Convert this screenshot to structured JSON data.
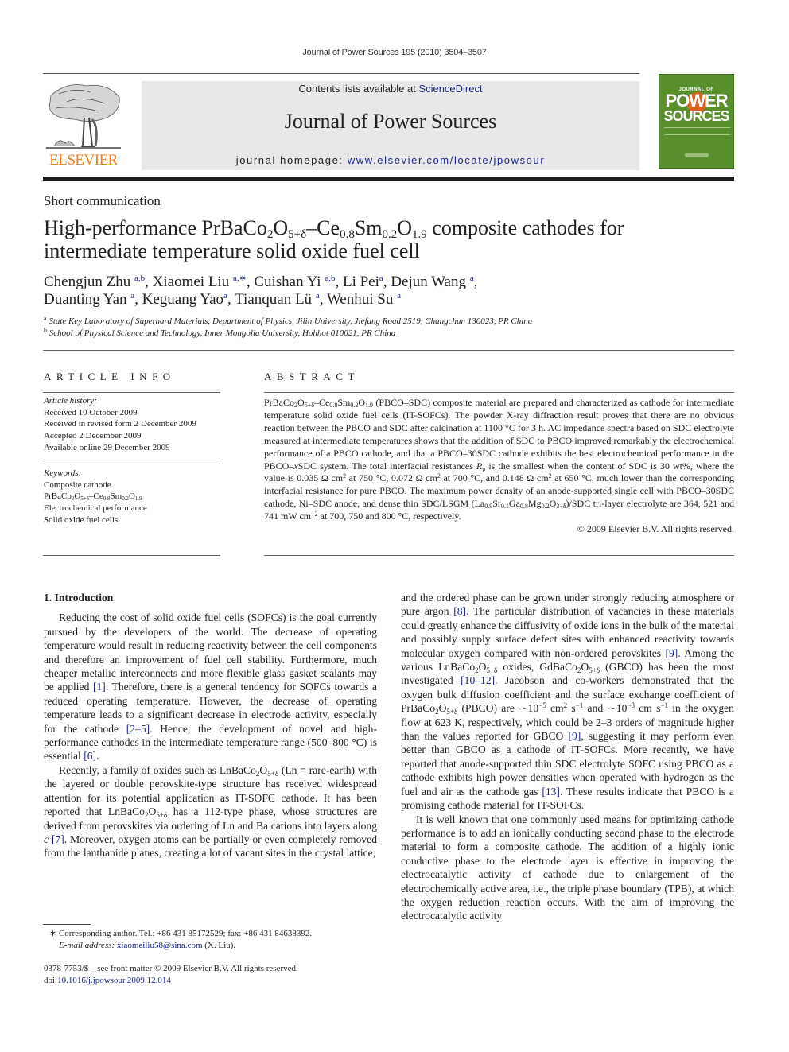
{
  "running_head": "Journal of Power Sources 195 (2010) 3504–3507",
  "banner": {
    "contents_prefix": "Contents lists available at ",
    "contents_link": "ScienceDirect",
    "journal_title": "Journal of Power Sources",
    "homepage_prefix": "journal homepage: ",
    "homepage_link": "www.elsevier.com/locate/jpowsour"
  },
  "publisher_logo": {
    "name": "ELSEVIER",
    "color": "#f07d1a",
    "icon": "elsevier-tree-icon"
  },
  "cover": {
    "line1": "JOURNAL OF",
    "line2": "POWER",
    "line3": "SOURCES",
    "color": "#5a8f2e",
    "accent": "#d9601f"
  },
  "article": {
    "section_type": "Short communication",
    "title_parts": {
      "t1": "High-performance PrBaCo",
      "s1": "2",
      "t2": "O",
      "s2": "5+δ",
      "t3": "–Ce",
      "s3": "0.8",
      "t4": "Sm",
      "s4": "0.2",
      "t5": "O",
      "s5": "1.9",
      "t6": " composite cathodes for",
      "line2": "intermediate temperature solid oxide fuel cell"
    },
    "authors": [
      {
        "name": "Chengjun Zhu",
        "aff": "a,b",
        "sep": ", "
      },
      {
        "name": "Xiaomei Liu",
        "aff": "a,∗",
        "sep": ", "
      },
      {
        "name": "Cuishan Yi",
        "aff": "a,b",
        "sep": ", "
      },
      {
        "name": "Li Pei",
        "aff": "a",
        "sep": ", "
      },
      {
        "name": "Dejun Wang",
        "aff": "a",
        "sep": ","
      },
      {
        "name": "Duanting Yan",
        "aff": "a",
        "sep": ", "
      },
      {
        "name": "Keguang Yao",
        "aff": "a",
        "sep": ", "
      },
      {
        "name": "Tianquan Lü",
        "aff": "a",
        "sep": ", "
      },
      {
        "name": "Wenhui Su",
        "aff": "a",
        "sep": ""
      }
    ],
    "affiliations": [
      {
        "key": "a",
        "text": "State Key Laboratory of Superhard Materials, Department of Physics, Jilin University, Jiefang Road 2519, Changchun 130023, PR China"
      },
      {
        "key": "b",
        "text": "School of Physical Science and Technology, Inner Mongolia University, Hohhot 010021, PR China"
      }
    ]
  },
  "article_info": {
    "heading": "ARTICLE INFO",
    "history_label": "Article history:",
    "history": [
      "Received 10 October 2009",
      "Received in revised form 2 December 2009",
      "Accepted 2 December 2009",
      "Available online 29 December 2009"
    ],
    "keywords_label": "Keywords:",
    "keywords": {
      "k1": "Composite cathode",
      "k2_parts": {
        "a": "PrBaCo",
        "b": "2",
        "c": "O",
        "d": "5+δ",
        "e": "–Ce",
        "f": "0.8",
        "g": "Sm",
        "h": "0.2",
        "i": "O",
        "j": "1.9"
      },
      "k3": "Electrochemical performance",
      "k4": "Solid oxide fuel cells"
    }
  },
  "abstract": {
    "heading": "ABSTRACT",
    "p": {
      "a1": "PrBaCo",
      "a1s": "2",
      "a2": "O",
      "a2s": "5+δ",
      "a3": "–Ce",
      "a3s": "0.8",
      "a4": "Sm",
      "a4s": "0.2",
      "a5": "O",
      "a5s": "1.9",
      "a6": " (PBCO–SDC) composite material are prepared and characterized as cathode for intermediate temperature solid oxide fuel cells (IT-SOFCs). The powder X-ray diffraction result proves that there are no obvious reaction between the PBCO and SDC after calcination at 1100 °C for 3 h. AC impedance spectra based on SDC electrolyte measured at intermediate temperatures shows that the addition of SDC to PBCO improved remarkably the electrochemical performance of a PBCO cathode, and that a PBCO–30SDC cathode exhibits the best electrochemical performance in the PBCO–",
      "a7": "x",
      "a8": "SDC system. The total interfacial resistances ",
      "a9": "R",
      "a9s": "p",
      "a10": " is the smallest when the content of SDC is 30 wt%, where the value is 0.035 Ω cm",
      "sq": "2",
      "a11": " at 750 °C, 0.072 Ω cm",
      "a12": " at 700 °C, and 0.148 Ω cm",
      "a13": " at 650 °C, much lower than the corresponding interfacial resistance for pure PBCO. The maximum power density of an anode-supported single cell with PBCO–30SDC cathode, Ni–SDC anode, and dense thin SDC/LSGM (La",
      "b1s": "0.9",
      "b2": "Sr",
      "b2s": "0.1",
      "b3": "Ga",
      "b3s": "0.8",
      "b4": "Mg",
      "b4s": "0.2",
      "b5": "O",
      "b5s": "3−δ",
      "b6": ")/SDC tri-layer electrolyte are 364, 521 and 741 mW cm",
      "b6sup": "−2",
      "b7": " at 700, 750 and 800 °C, respectively."
    },
    "copyright": "© 2009 Elsevier B.V. All rights reserved."
  },
  "body": {
    "section_heading": "1.  Introduction",
    "left": {
      "p1a": "Reducing the cost of solid oxide fuel cells (SOFCs) is the goal currently pursued by the developers of the world. The decrease of operating temperature would result in reducing reactivity between the cell components and therefore an improvement of fuel cell stability. Furthermore, much cheaper metallic interconnects and more flexible glass gasket sealants may be applied ",
      "ref1": "[1]",
      "p1b": ". Therefore, there is a general tendency for SOFCs towards a reduced operating temperature. However, the decrease of operating temperature leads to a significant decrease in electrode activity, especially for the cathode ",
      "ref2": "[2–5]",
      "p1c": ". Hence, the development of novel and high-performance cathodes in the intermediate temperature range (500–800 °C) is essential ",
      "ref3": "[6]",
      "p1d": ".",
      "p2a": "Recently, a family of oxides such as LnBaCo",
      "s2": "2",
      "o": "O",
      "s5d": "5+δ",
      "p2b": " (Ln = rare-earth) with the layered or double perovskite-type structure has received widespread attention for its potential application as IT-SOFC cathode. It has been reported that LnBaCo",
      "p2c": " has a 112-type phase, whose structures are derived from perovskites via ordering of Ln and Ba cations into layers along ",
      "c": "c",
      "ref4": "[7]",
      "p2d": ". Moreover, oxygen atoms can be partially or even completely removed from the lanthanide planes, creating a lot of vacant sites in the crystal lattice,"
    },
    "right": {
      "p1a": "and the ordered phase can be grown under strongly reducing atmosphere or pure argon ",
      "ref8": "[8]",
      "p1b": ". The particular distribution of vacancies in these materials could greatly enhance the diffusivity of oxide ions in the bulk of the material and possibly supply surface defect sites with enhanced reactivity towards molecular oxygen compared with non-ordered perovskites ",
      "ref9": "[9]",
      "p1c": ". Among the various LnBaCo",
      "p1d": " oxides, GdBaCo",
      "p1e": " (GBCO) has been the most investigated ",
      "ref10": "[10–12]",
      "p1f": ". Jacobson and co-workers demonstrated that the oxygen bulk diffusion coefficient and the surface exchange coefficient of PrBaCo",
      "p1g": " (PBCO) are ∼10",
      "e5": "−5",
      "p1h": " cm",
      "sq": "2",
      "p1i": " s",
      "em1": "−1",
      "p1j": " and ∼10",
      "e3": "−3",
      "p1k": " cm s",
      "p1l": " in the oxygen flow at 623 K, respectively, which could be 2–3 orders of magnitude higher than the values reported for GBCO ",
      "p1m": ", suggesting it may perform even better than GBCO as a cathode of IT-SOFCs. More recently, we have reported that anode-supported thin SDC electrolyte SOFC using PBCO as a cathode exhibits high power densities when operated with hydrogen as the fuel and air as the cathode gas ",
      "ref13": "[13]",
      "p1n": ". These results indicate that PBCO is a promising cathode material for IT-SOFCs.",
      "p2": "It is well known that one commonly used means for optimizing cathode performance is to add an ionically conducting second phase to the electrode material to form a composite cathode. The addition of a highly ionic conductive phase to the electrode layer is effective in improving the electrocatalytic activity of cathode due to enlargement of the electrochemically active area, i.e., the triple phase boundary (TPB), at which the oxygen reduction reaction occurs. With the aim of improving the electrocatalytic activity"
    }
  },
  "footnote": {
    "star": "∗",
    "corresponding": " Corresponding author. Tel.: +86 431 85172529; fax: +86 431 84638392.",
    "email_label": "E-mail address:",
    "email": "xiaomeiliu58@sina.com",
    "email_suffix": " (X. Liu)."
  },
  "front_matter": {
    "issn_line": "0378-7753/$ – see front matter © 2009 Elsevier B.V. All rights reserved.",
    "doi_label": "doi:",
    "doi": "10.1016/j.jpowsour.2009.12.014"
  }
}
